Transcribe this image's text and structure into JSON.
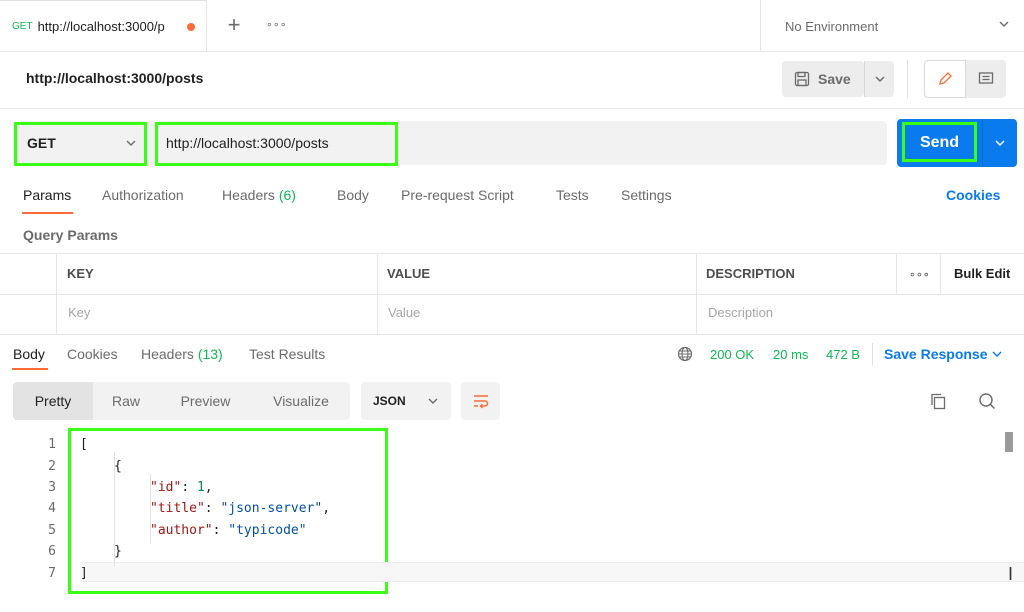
{
  "tab": {
    "method": "GET",
    "url": "http://localhost:3000/p"
  },
  "environment": "No Environment",
  "request": {
    "title": "http://localhost:3000/posts",
    "save_label": "Save",
    "method": "GET",
    "url": "http://localhost:3000/posts",
    "send_label": "Send"
  },
  "request_tabs": [
    {
      "label": "Params"
    },
    {
      "label": "Authorization"
    },
    {
      "label": "Headers",
      "count": "(6)"
    },
    {
      "label": "Body"
    },
    {
      "label": "Pre-request Script"
    },
    {
      "label": "Tests"
    },
    {
      "label": "Settings"
    }
  ],
  "cookies_label": "Cookies",
  "query_params": {
    "title": "Query Params",
    "columns": [
      "KEY",
      "VALUE",
      "DESCRIPTION",
      "Bulk Edit"
    ],
    "placeholders": [
      "Key",
      "Value",
      "Description"
    ]
  },
  "response_tabs": [
    {
      "label": "Body"
    },
    {
      "label": "Cookies"
    },
    {
      "label": "Headers",
      "count": "(13)"
    },
    {
      "label": "Test Results"
    }
  ],
  "response": {
    "status": "200 OK",
    "time": "20 ms",
    "size": "472 B",
    "save_label": "Save Response"
  },
  "view_modes": [
    "Pretty",
    "Raw",
    "Preview",
    "Visualize"
  ],
  "language": "JSON",
  "body_lines": [
    "1",
    "2",
    "3",
    "4",
    "5",
    "6",
    "7"
  ],
  "body": {
    "open_bracket": "[",
    "open_brace": "{",
    "k_id": "\"id\"",
    "v_id": "1",
    "k_title": "\"title\"",
    "v_title": "\"json-server\"",
    "k_author": "\"author\"",
    "v_author": "\"typicode\"",
    "close_brace": "}",
    "close_bracket": "]"
  },
  "colors": {
    "accent": "#ff6c37",
    "primary": "#097bed",
    "success": "#0cbb52",
    "highlight": "#39ff14"
  },
  "icons": [
    "plus-icon",
    "more-icon",
    "chevron-down-icon",
    "save-icon",
    "pencil-icon",
    "comment-icon",
    "globe-icon",
    "wrap-lines-icon",
    "copy-icon",
    "search-icon"
  ]
}
